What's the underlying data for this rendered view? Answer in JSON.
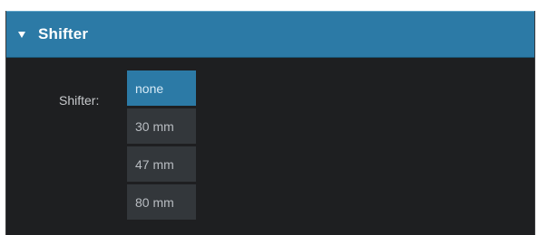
{
  "section": {
    "title": "Shifter",
    "collapse_icon": "triangle-down-icon"
  },
  "field": {
    "label": "Shifter:",
    "selected": "none",
    "options": [
      "none",
      "30 mm",
      "47 mm",
      "80 mm"
    ]
  },
  "colors": {
    "header_bg": "#2c7aa6",
    "panel_bg": "#1e1f21",
    "option_bg": "#33373b",
    "selected_bg": "#2c7aa6"
  }
}
